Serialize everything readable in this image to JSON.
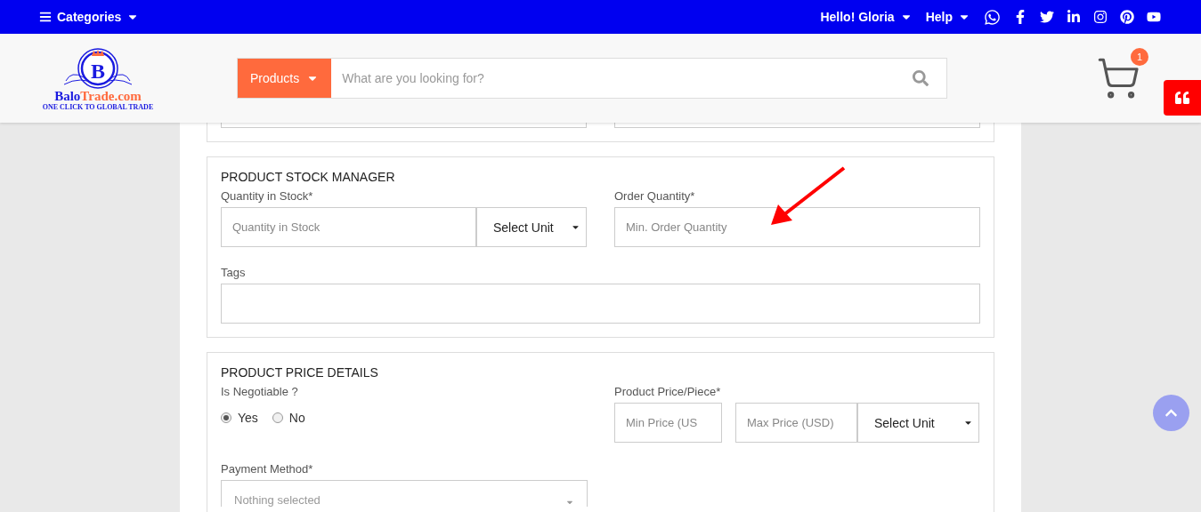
{
  "top_bar": {
    "categories": "Categories",
    "greeting": "Hello! Gloria",
    "help": "Help"
  },
  "header": {
    "logo": {
      "initial": "B",
      "name_first": "Balo",
      "name_second": "Trade.com",
      "tagline": "ONE CLICK TO GLOBAL TRADE"
    },
    "search": {
      "category": "Products",
      "placeholder": "What are you looking for?"
    },
    "cart": {
      "count": "1"
    }
  },
  "stock_section": {
    "title": "PRODUCT STOCK MANAGER",
    "quantity": {
      "label": "Quantity in Stock*",
      "placeholder": "Quantity in Stock",
      "unit": "Select Unit"
    },
    "order": {
      "label": "Order Quantity*",
      "placeholder": "Min. Order Quantity"
    },
    "tags": {
      "label": "Tags"
    }
  },
  "price_section": {
    "title": "PRODUCT PRICE DETAILS",
    "negotiable": {
      "label": "Is Negotiable ?",
      "options": [
        {
          "label": "Yes",
          "selected": true
        },
        {
          "label": "No",
          "selected": false
        }
      ]
    },
    "price": {
      "label": "Product Price/Piece*",
      "min_placeholder": "Min Price (US",
      "max_placeholder": "Max Price (USD)",
      "unit": "Select Unit"
    },
    "payment": {
      "label": "Payment Method*",
      "placeholder": "Nothing selected"
    }
  }
}
